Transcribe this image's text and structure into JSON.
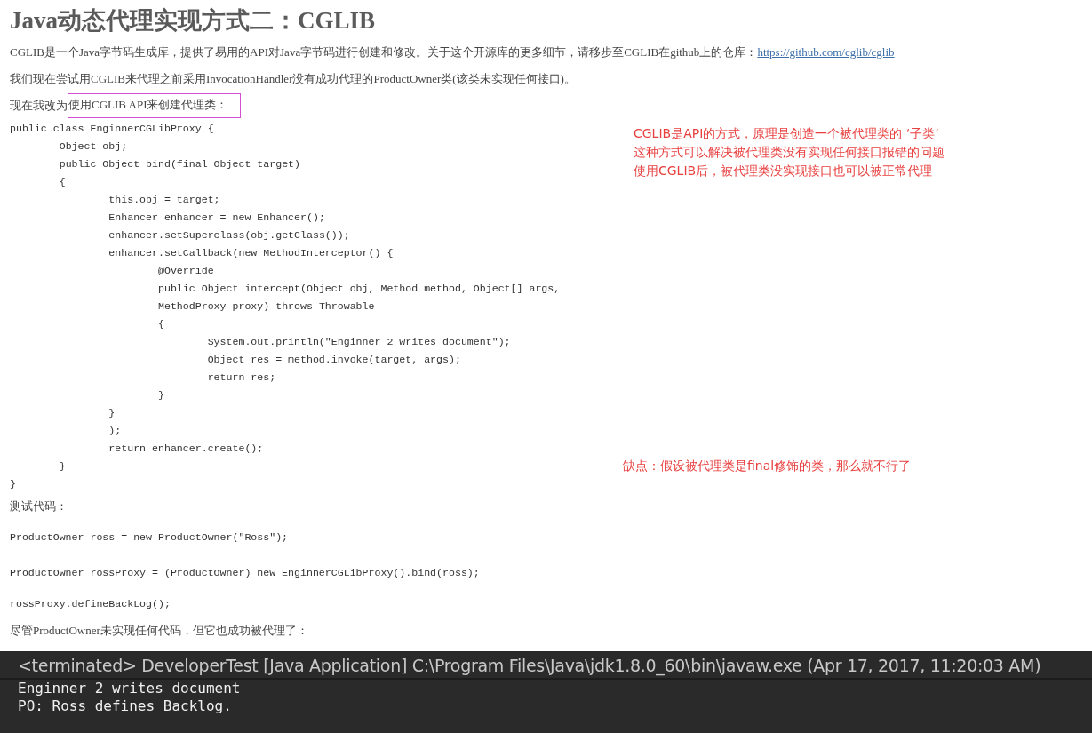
{
  "title": "Java动态代理实现方式二：CGLIB",
  "intro": {
    "text": "CGLIB是一个Java字节码生成库，提供了易用的API对Java字节码进行创建和修改。关于这个开源库的更多细节，请移步至CGLIB在github上的仓库：",
    "link": "https://github.com/cglib/cglib"
  },
  "paragraph": "我们现在尝试用CGLIB来代理之前采用InvocationHandler没有成功代理的ProductOwner类(该类未实现任何接口)。",
  "highlight_paragraph": {
    "prefix": "现在我改为",
    "highlight": "使用CGLIB API来创建代理类："
  },
  "code_lines": [
    "public class EnginnerCGLibProxy {",
    "\tObject obj;",
    "\tpublic Object bind(final Object target)",
    "\t{",
    "\t\tthis.obj = target;",
    "\t\tEnhancer enhancer = new Enhancer();",
    "\t\tenhancer.setSuperclass(obj.getClass());",
    "\t\tenhancer.setCallback(new MethodInterceptor() {",
    "\t\t\t@Override",
    "\t\t\tpublic Object intercept(Object obj, Method method, Object[] args,",
    "\t\t\tMethodProxy proxy) throws Throwable",
    "\t\t\t{",
    "\t\t\t\tSystem.out.println(\"Enginner 2 writes document\");",
    "\t\t\t\tObject res = method.invoke(target, args);",
    "\t\t\t\treturn res;",
    "\t\t\t}",
    "\t\t}",
    "\t\t);",
    "\t\treturn enhancer.create();",
    "\t}",
    "}"
  ],
  "annotations": [
    {
      "lines": [
        "CGLIB是API的方式，原理是创造一个被代理类的 ‘子类’",
        "这种方式可以解决被代理类没有实现任何接口报错的问题",
        "使用CGLIB后，被代理类没实现接口也可以被正常代理"
      ]
    },
    {
      "lines": [
        "缺点：假设被代理类是final修饰的类，那么就不行了"
      ]
    }
  ],
  "test_label": "测试代码：",
  "test_lines": [
    "ProductOwner ross = new ProductOwner(\"Ross\");",
    "ProductOwner rossProxy = (ProductOwner) new EnginnerCGLibProxy().bind(ross);",
    "rossProxy.defineBackLog();"
  ],
  "conclusion": "尽管ProductOwner未实现任何代码，但它也成功被代理了：",
  "console": {
    "header": "<terminated> DeveloperTest [Java Application] C:\\Program Files\\Java\\jdk1.8.0_60\\bin\\javaw.exe (Apr 17, 2017, 11:20:03 AM)",
    "lines": [
      "Enginner 2 writes document",
      "PO: Ross defines Backlog."
    ]
  }
}
